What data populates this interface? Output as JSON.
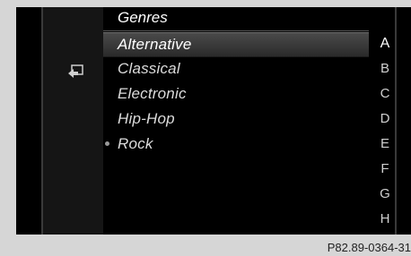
{
  "header": {
    "title": "Genres"
  },
  "list": {
    "items": [
      {
        "label": "Alternative",
        "selected": true,
        "marked": false
      },
      {
        "label": "Classical",
        "selected": false,
        "marked": false
      },
      {
        "label": "Electronic",
        "selected": false,
        "marked": false
      },
      {
        "label": "Hip-Hop",
        "selected": false,
        "marked": false
      },
      {
        "label": "Rock",
        "selected": false,
        "marked": true
      }
    ]
  },
  "alpha_index": [
    "A",
    "B",
    "C",
    "D",
    "E",
    "F",
    "G",
    "H"
  ],
  "alpha_active": "A",
  "back_icon": "back-arrow-icon",
  "caption": "P82.89-0364-31"
}
